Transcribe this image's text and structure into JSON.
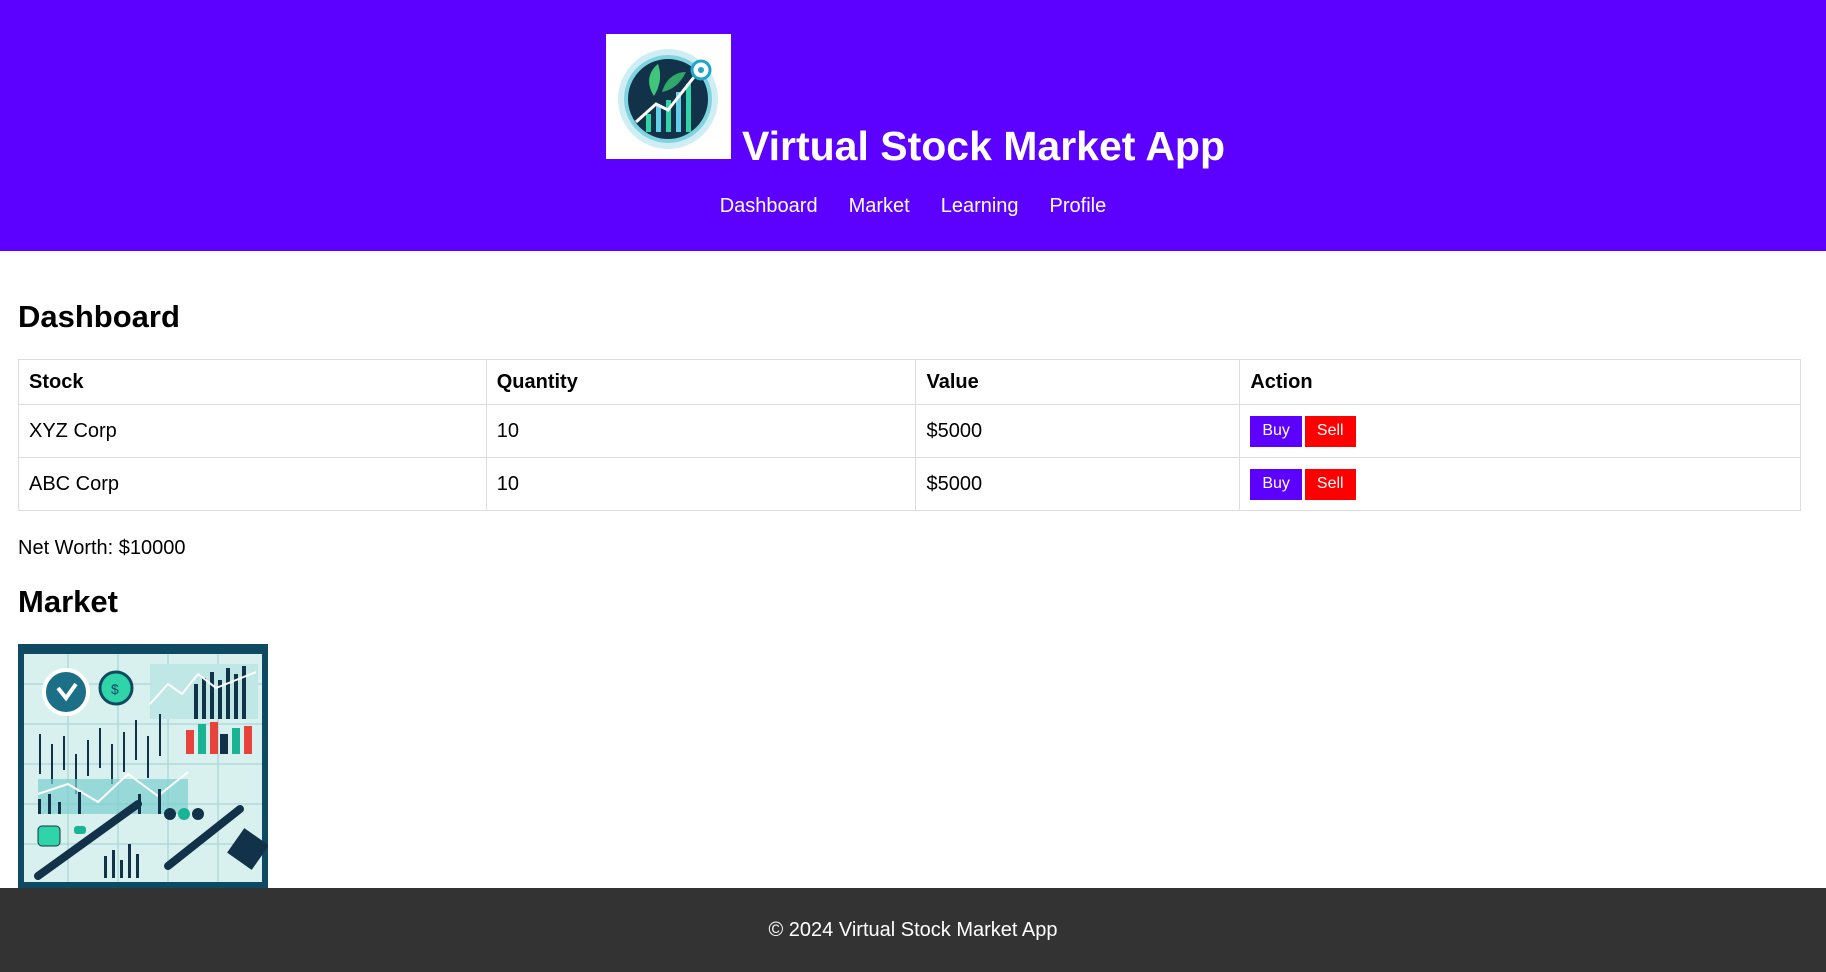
{
  "header": {
    "title": "Virtual Stock Market App",
    "logo_icon": "growth-chart-logo-icon",
    "nav": [
      {
        "label": "Dashboard"
      },
      {
        "label": "Market"
      },
      {
        "label": "Learning"
      },
      {
        "label": "Profile"
      }
    ]
  },
  "dashboard": {
    "title": "Dashboard",
    "columns": [
      "Stock",
      "Quantity",
      "Value",
      "Action"
    ],
    "rows": [
      {
        "stock": "XYZ Corp",
        "quantity": "10",
        "value": "$5000",
        "buy_label": "Buy",
        "sell_label": "Sell"
      },
      {
        "stock": "ABC Corp",
        "quantity": "10",
        "value": "$5000",
        "buy_label": "Buy",
        "sell_label": "Sell"
      }
    ],
    "net_worth": "Net Worth: $10000"
  },
  "market": {
    "title": "Market",
    "image_icon": "market-charts-illustration"
  },
  "footer": {
    "text": "© 2024 Virtual Stock Market App"
  },
  "colors": {
    "header_bg": "#5c00ff",
    "buy_button": "#5c00ff",
    "sell_button": "#ff0000",
    "footer_bg": "#333333"
  }
}
